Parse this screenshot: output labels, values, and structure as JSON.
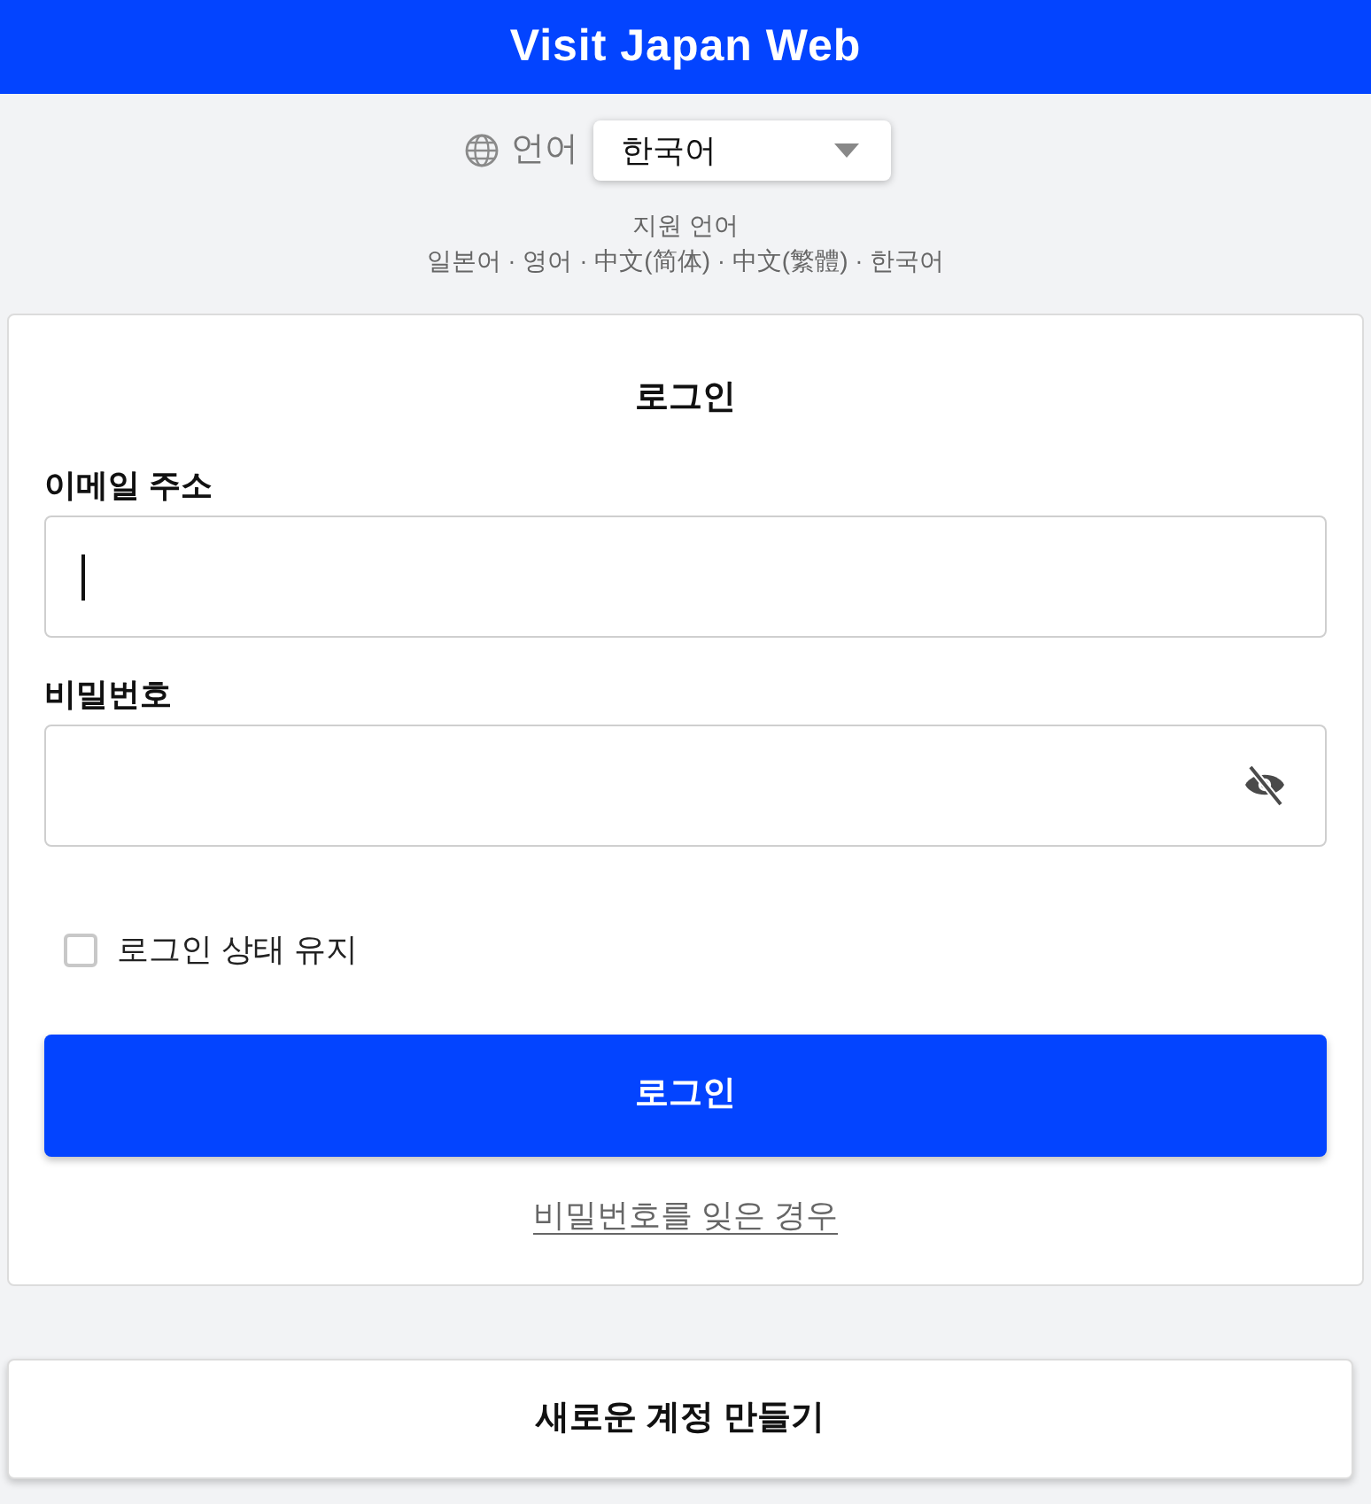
{
  "header": {
    "title": "Visit Japan Web"
  },
  "language": {
    "label": "언어",
    "selected_value": "한국어"
  },
  "supported_languages": {
    "title": "지원 언어",
    "list": "일본어 · 영어 · 中文(简体) · 中文(繁體) · 한국어"
  },
  "login_form": {
    "title": "로그인",
    "fields": [
      {
        "label": "이메일 주소",
        "kind": "email",
        "focused": true
      },
      {
        "label": "비밀번호",
        "kind": "password",
        "focused": false,
        "password_hidden": true
      }
    ],
    "remember_me": {
      "label": "로그인 상태 유지",
      "checked": false
    },
    "submit_button": "로그인",
    "forgot_password_link": "비밀번호를 잊은 경우"
  },
  "create_account_button": "새로운 계정 만들기"
}
